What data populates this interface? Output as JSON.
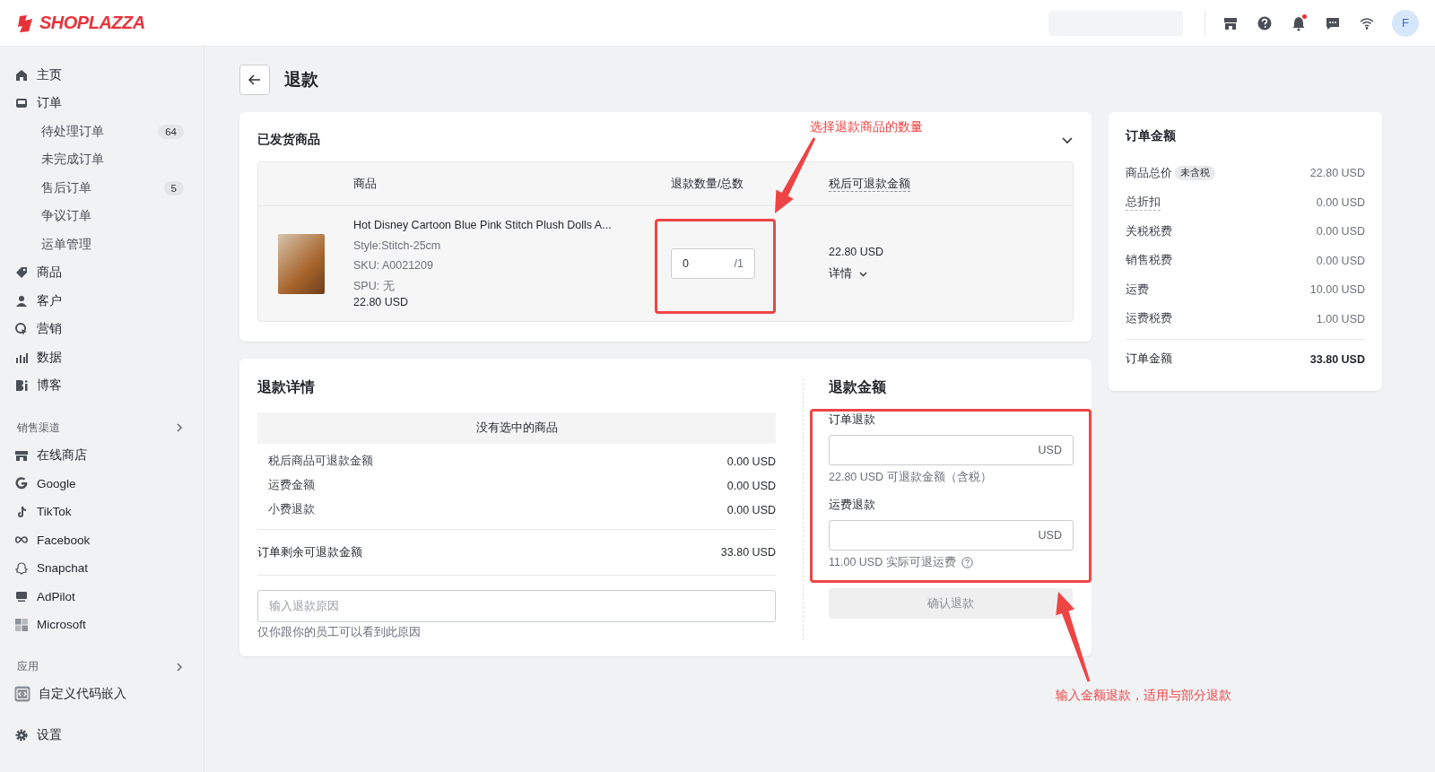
{
  "header": {
    "logo": "SHOPLAZZA",
    "notification_dot": true,
    "avatar": "F"
  },
  "sidebar": {
    "main_items": [
      {
        "label": "主页"
      },
      {
        "label": "订单",
        "children": [
          {
            "label": "待处理订单",
            "badge": "64"
          },
          {
            "label": "未完成订单"
          },
          {
            "label": "售后订单",
            "badge": "5"
          },
          {
            "label": "争议订单"
          },
          {
            "label": "运单管理"
          }
        ]
      },
      {
        "label": "商品"
      },
      {
        "label": "客户"
      },
      {
        "label": "营销"
      },
      {
        "label": "数据"
      },
      {
        "label": "博客"
      }
    ],
    "sections": [
      {
        "title": "销售渠道",
        "items": [
          {
            "label": "在线商店"
          },
          {
            "label": "Google"
          },
          {
            "label": "TikTok"
          },
          {
            "label": "Facebook"
          },
          {
            "label": "Snapchat"
          },
          {
            "label": "AdPilot"
          },
          {
            "label": "Microsoft"
          }
        ]
      },
      {
        "title": "应用",
        "items": [
          {
            "label": "自定义代码嵌入"
          }
        ]
      }
    ],
    "settings": "设置"
  },
  "page": {
    "title": "退款"
  },
  "shipped": {
    "title": "已发货商品",
    "expanded": true,
    "columns": [
      "商品",
      "退款数量/总数",
      "税后可退款金额"
    ],
    "items": [
      {
        "name": "Hot Disney Cartoon Blue Pink Stitch Plush Dolls A...",
        "style": "Style:Stitch-25cm",
        "sku": "SKU: A0021209",
        "spu": "SPU: 无",
        "price": "22.80 USD",
        "quantity": "0",
        "total": "/1",
        "refundable": "22.80 USD",
        "details": "详情"
      }
    ]
  },
  "refund_details": {
    "title": "退款详情",
    "empty_notice": "没有选中的商品",
    "rows": [
      {
        "label": "税后商品可退款金额",
        "value": "0.00 USD"
      },
      {
        "label": "运费金额",
        "value": "0.00 USD"
      },
      {
        "label": "小费退款",
        "value": "0.00 USD"
      }
    ],
    "remaining": {
      "label": "订单剩余可退款金额",
      "value": "33.80 USD"
    },
    "reason": {
      "placeholder": "输入退款原因",
      "hint": "仅你跟你的员工可以看到此原因"
    }
  },
  "refund_amount": {
    "title": "退款金额",
    "fields": [
      {
        "label": "订单退款",
        "suffix": "USD",
        "hint": "22.80 USD 可退款金额（含税）",
        "help": false
      },
      {
        "label": "运费退款",
        "suffix": "USD",
        "hint": "11.00 USD 实际可退运费",
        "help": true
      }
    ],
    "button": {
      "label": "确认退款",
      "disabled": true
    }
  },
  "order_summary": {
    "title": "订单金额",
    "rows": [
      {
        "label": "商品总价",
        "tag": "未含税",
        "value": "22.80 USD",
        "underlined": false
      },
      {
        "label": "总折扣",
        "value": "0.00 USD",
        "underlined": true
      },
      {
        "label": "关税税费",
        "value": "0.00 USD",
        "underlined": false
      },
      {
        "label": "销售税费",
        "value": "0.00 USD",
        "underlined": false
      },
      {
        "label": "运费",
        "value": "10.00 USD",
        "underlined": false
      },
      {
        "label": "运费税费",
        "value": "1.00 USD",
        "underlined": false
      }
    ],
    "total": {
      "label": "订单金额",
      "value": "33.80 USD"
    }
  },
  "annotations": [
    {
      "text": "选择退款商品的数量"
    },
    {
      "text": "输入金额退款，适用与部分退款"
    }
  ]
}
